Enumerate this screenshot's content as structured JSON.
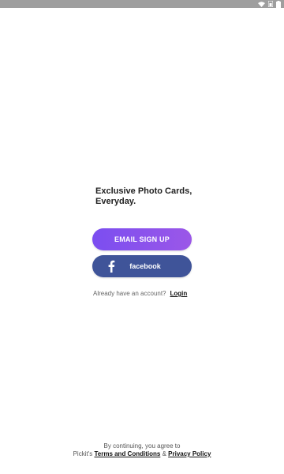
{
  "tagline": {
    "line1": "Exclusive Photo Cards,",
    "line2": "Everyday."
  },
  "buttons": {
    "email_signup": "EMAIL SIGN UP",
    "facebook": "facebook"
  },
  "account": {
    "prompt": "Already have an account?",
    "login": "Login"
  },
  "legal": {
    "line1": "By continuing, you agree to",
    "prefix": "Pickit's",
    "terms": "Terms and Conditions",
    "joiner": "&",
    "privacy": "Privacy Policy"
  },
  "colors": {
    "email_button_start": "#7b4ef0",
    "email_button_end": "#9b57e8",
    "facebook_button": "#3f5499",
    "status_bar": "#9e9e9e"
  },
  "icons": {
    "status": [
      "wifi-icon",
      "signal-icon",
      "battery-icon"
    ],
    "facebook": "facebook-icon"
  }
}
